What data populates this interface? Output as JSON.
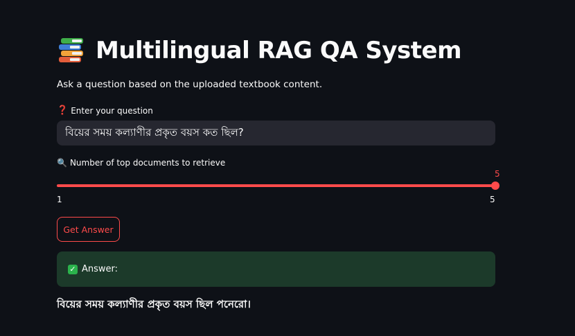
{
  "app": {
    "title": "Multilingual RAG QA System",
    "title_icon": "books-icon",
    "subtitle": "Ask a question based on the uploaded textbook content."
  },
  "question": {
    "label_icon": "question-mark-icon",
    "label_icon_glyph": "❓",
    "label": "Enter your question",
    "value": "বিয়ের সময় কল্যাণীর প্রকৃত বয়স কত ছিল?"
  },
  "top_k": {
    "label_icon": "magnifier-icon",
    "label_icon_glyph": "🔍",
    "label": "Number of top documents to retrieve",
    "value": "5",
    "min": "1",
    "max": "5",
    "fill_fraction": 1.0
  },
  "actions": {
    "get_answer_label": "Get Answer"
  },
  "answer": {
    "icon": "check-icon",
    "icon_glyph": "✓",
    "label": "Answer:",
    "text": "বিয়ের সময় কল্যাণীর প্রকৃত বয়স ছিল পনেরো।"
  },
  "colors": {
    "background": "#0e1117",
    "accent": "#ff4b4b",
    "input_bg": "#262730",
    "success_bg": "#1c3a2a",
    "success_icon": "#2bb24c"
  }
}
